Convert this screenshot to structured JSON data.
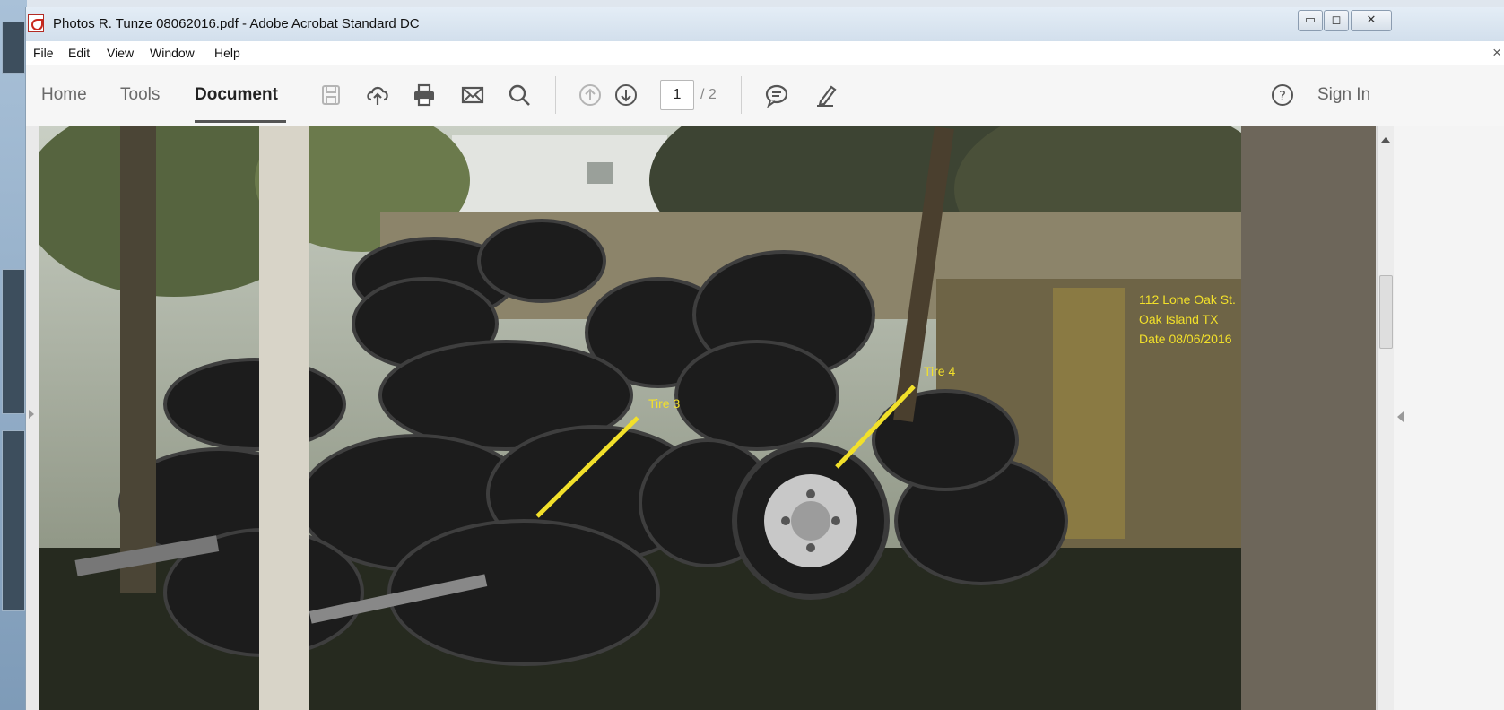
{
  "window": {
    "title": "Photos R. Tunze 08062016.pdf - Adobe Acrobat Standard DC",
    "controls": {
      "minimize": "▭",
      "maximize": "◻",
      "close": "✕"
    }
  },
  "menu": {
    "items": [
      "File",
      "Edit",
      "View",
      "Window",
      "Help"
    ],
    "close_label": "×"
  },
  "toolbar": {
    "tabs": [
      {
        "label": "Home",
        "active": false
      },
      {
        "label": "Tools",
        "active": false
      },
      {
        "label": "Document",
        "active": true
      }
    ],
    "icons": [
      "save-icon",
      "upload-cloud-icon",
      "print-icon",
      "email-icon",
      "search-icon",
      "page-up-icon",
      "page-down-icon",
      "comment-icon",
      "pen-icon",
      "help-icon"
    ],
    "page_current": "1",
    "page_total": "/ 2",
    "sign_in": "Sign In"
  },
  "photo": {
    "annotation_lines": [
      "112 Lone Oak St.",
      "Oak Island TX",
      "Date 08/06/2016"
    ],
    "callouts": [
      {
        "label": "Tire 3"
      },
      {
        "label": "Tire 4"
      }
    ],
    "annotation_color": "#f2e02a"
  }
}
